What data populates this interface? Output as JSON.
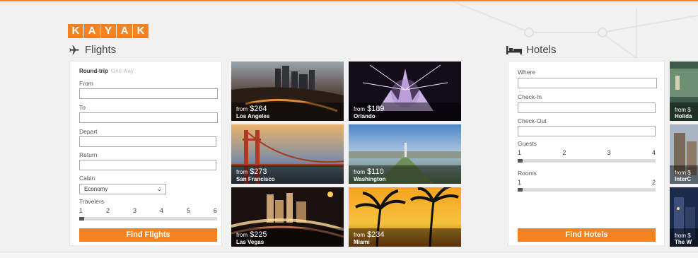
{
  "brand": {
    "letters": [
      "K",
      "A",
      "Y",
      "A",
      "K"
    ],
    "accent": "#f58220"
  },
  "flights": {
    "title": "Flights",
    "icon": "airplane-icon",
    "trip_type": {
      "active": "Round-trip",
      "inactive": "One-way"
    },
    "from_label": "From",
    "to_label": "To",
    "depart_label": "Depart",
    "return_label": "Return",
    "cabin_label": "Cabin",
    "cabin_value": "Economy",
    "travelers_label": "Travelers",
    "travelers_scale": [
      "1",
      "2",
      "3",
      "4",
      "5",
      "6"
    ],
    "travelers_selected": 1,
    "button": "Find Flights"
  },
  "deals": [
    {
      "from": "from",
      "price": "$264",
      "city": "Los Angeles"
    },
    {
      "from": "from",
      "price": "$189",
      "city": "Orlando"
    },
    {
      "from": "from",
      "price": "$273",
      "city": "San Francisco"
    },
    {
      "from": "from",
      "price": "$110",
      "city": "Washington"
    },
    {
      "from": "from",
      "price": "$225",
      "city": "Las Vegas"
    },
    {
      "from": "from",
      "price": "$234",
      "city": "Miami"
    }
  ],
  "hotels": {
    "title": "Hotels",
    "icon": "bed-icon",
    "where_label": "Where",
    "checkin_label": "Check-In",
    "checkout_label": "Check-Out",
    "guests_label": "Guests",
    "guests_scale": [
      "1",
      "2",
      "3",
      "4"
    ],
    "guests_selected": 1,
    "rooms_label": "Rooms",
    "rooms_scale": [
      "1",
      "2"
    ],
    "rooms_selected": 1,
    "button": "Find Hotels"
  },
  "hotel_deals": [
    {
      "price": "from $",
      "city": "Holida"
    },
    {
      "price": "from $",
      "city": "InterC"
    },
    {
      "price": "from $",
      "city": "The W"
    }
  ]
}
